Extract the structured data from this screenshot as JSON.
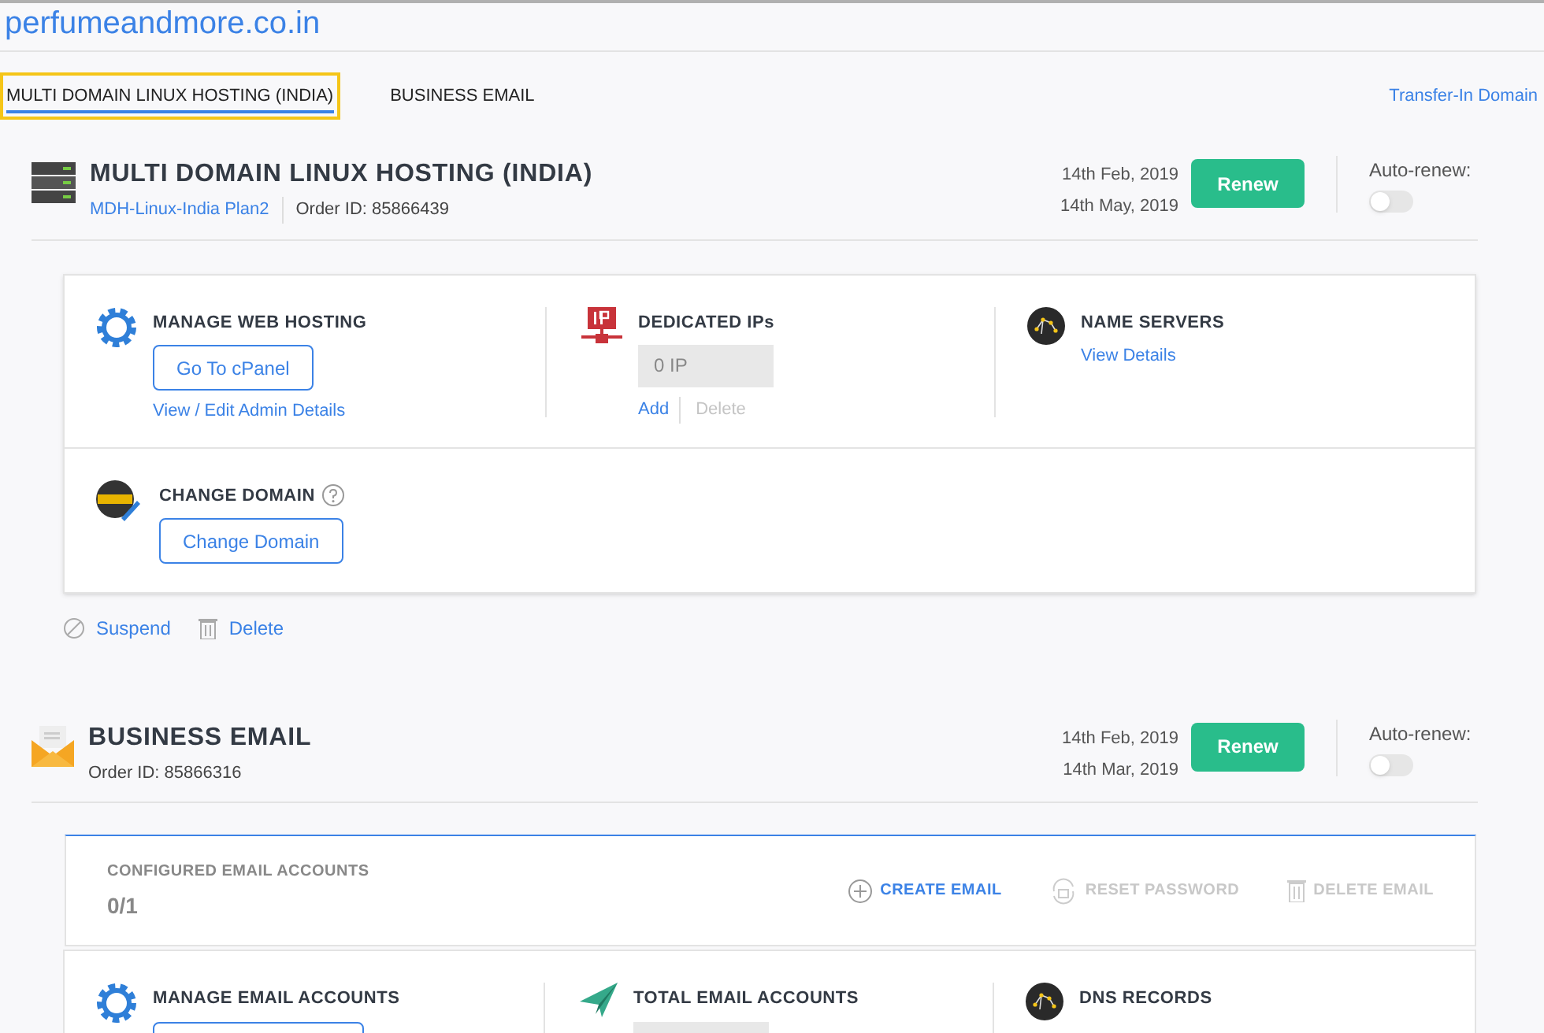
{
  "site_title": "perfumeandmore.co.in",
  "tabs": [
    {
      "label": "MULTI DOMAIN LINUX HOSTING (INDIA)",
      "selected": true,
      "highlighted": true
    },
    {
      "label": "BUSINESS EMAIL",
      "selected": false,
      "highlighted": false
    }
  ],
  "transfer_link": "Transfer-In Domain",
  "hosting": {
    "title": "MULTI DOMAIN LINUX HOSTING (INDIA)",
    "plan": "MDH-Linux-India Plan2",
    "order_id": "Order ID: 85866439",
    "dates": [
      "14th Feb, 2019",
      "14th May, 2019"
    ],
    "renew": "Renew",
    "auto_renew_label": "Auto-renew:",
    "auto_renew": false,
    "panels": [
      {
        "kind": "cpanel",
        "title": "MANAGE WEB HOSTING",
        "button": "Go To cPanel",
        "link": "View / Edit Admin Details"
      },
      {
        "kind": "ips",
        "title": "DEDICATED IPs",
        "value": "0 IP",
        "add": "Add",
        "delete": "Delete",
        "delete_disabled": true
      },
      {
        "kind": "nameservers",
        "title": "NAME SERVERS",
        "link": "View Details"
      }
    ],
    "change_domain": {
      "title": "CHANGE DOMAIN",
      "button": "Change Domain"
    },
    "actions": [
      {
        "kind": "suspend",
        "label": "Suspend"
      },
      {
        "kind": "delete",
        "label": "Delete"
      }
    ]
  },
  "email": {
    "title": "BUSINESS EMAIL",
    "order_id": "Order ID: 85866316",
    "dates": [
      "14th Feb, 2019",
      "14th Mar, 2019"
    ],
    "renew": "Renew",
    "auto_renew_label": "Auto-renew:",
    "auto_renew": false,
    "configured_label": "CONFIGURED EMAIL ACCOUNTS",
    "configured_value": "0/1",
    "actions": [
      {
        "kind": "create",
        "label": "CREATE EMAIL",
        "disabled": false
      },
      {
        "kind": "reset",
        "label": "RESET PASSWORD",
        "disabled": true
      },
      {
        "kind": "delete",
        "label": "DELETE EMAIL",
        "disabled": true
      }
    ],
    "panels": [
      {
        "kind": "manage",
        "title": "MANAGE EMAIL ACCOUNTS"
      },
      {
        "kind": "total",
        "title": "TOTAL EMAIL ACCOUNTS"
      },
      {
        "kind": "dns",
        "title": "DNS RECORDS"
      }
    ]
  }
}
